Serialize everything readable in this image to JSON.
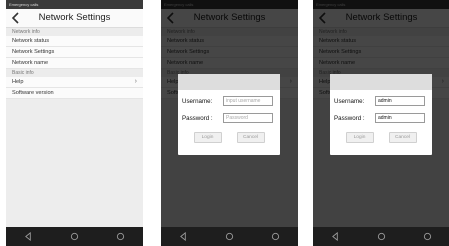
{
  "status_bar": {
    "left_1": "Emergency calls  ",
    "left_2": "Emergency calls  ",
    "left_3": "Emergency calls  ",
    "right": "",
    "time": ""
  },
  "header": {
    "title": "Network Settings"
  },
  "sections": {
    "network": "Network info",
    "basic": "Basic info"
  },
  "rows": {
    "network_status": {
      "label": "Network status",
      "value": ""
    },
    "network_settings": {
      "label": "Network Settings",
      "value": ""
    },
    "network_name": {
      "label": "Network name",
      "value": ""
    },
    "help": {
      "label": "Help"
    },
    "software_version": {
      "label": "Software version",
      "value": ""
    }
  },
  "dialog_empty": {
    "username_label": "Username:",
    "username_placeholder": "input username",
    "username_value": "",
    "password_label": "Password :",
    "password_placeholder": "Password",
    "password_value": "",
    "login_label": "Login",
    "cancel_label": "Cancel"
  },
  "dialog_filled": {
    "username_label": "Username:",
    "username_placeholder": "input username",
    "username_value": "admin",
    "password_label": "Password :",
    "password_placeholder": "Password",
    "password_value": "admin",
    "login_label": "Login",
    "cancel_label": "Cancel"
  },
  "icons": {
    "back": "chevron-left-icon",
    "nav_back": "triangle-back-icon",
    "nav_home": "circle-home-icon",
    "nav_recent": "circle-recent-icon"
  },
  "colors": {
    "status_bar": "#3a3a3a",
    "nav_bar": "#1e1e1e",
    "overlay": "#000000"
  }
}
